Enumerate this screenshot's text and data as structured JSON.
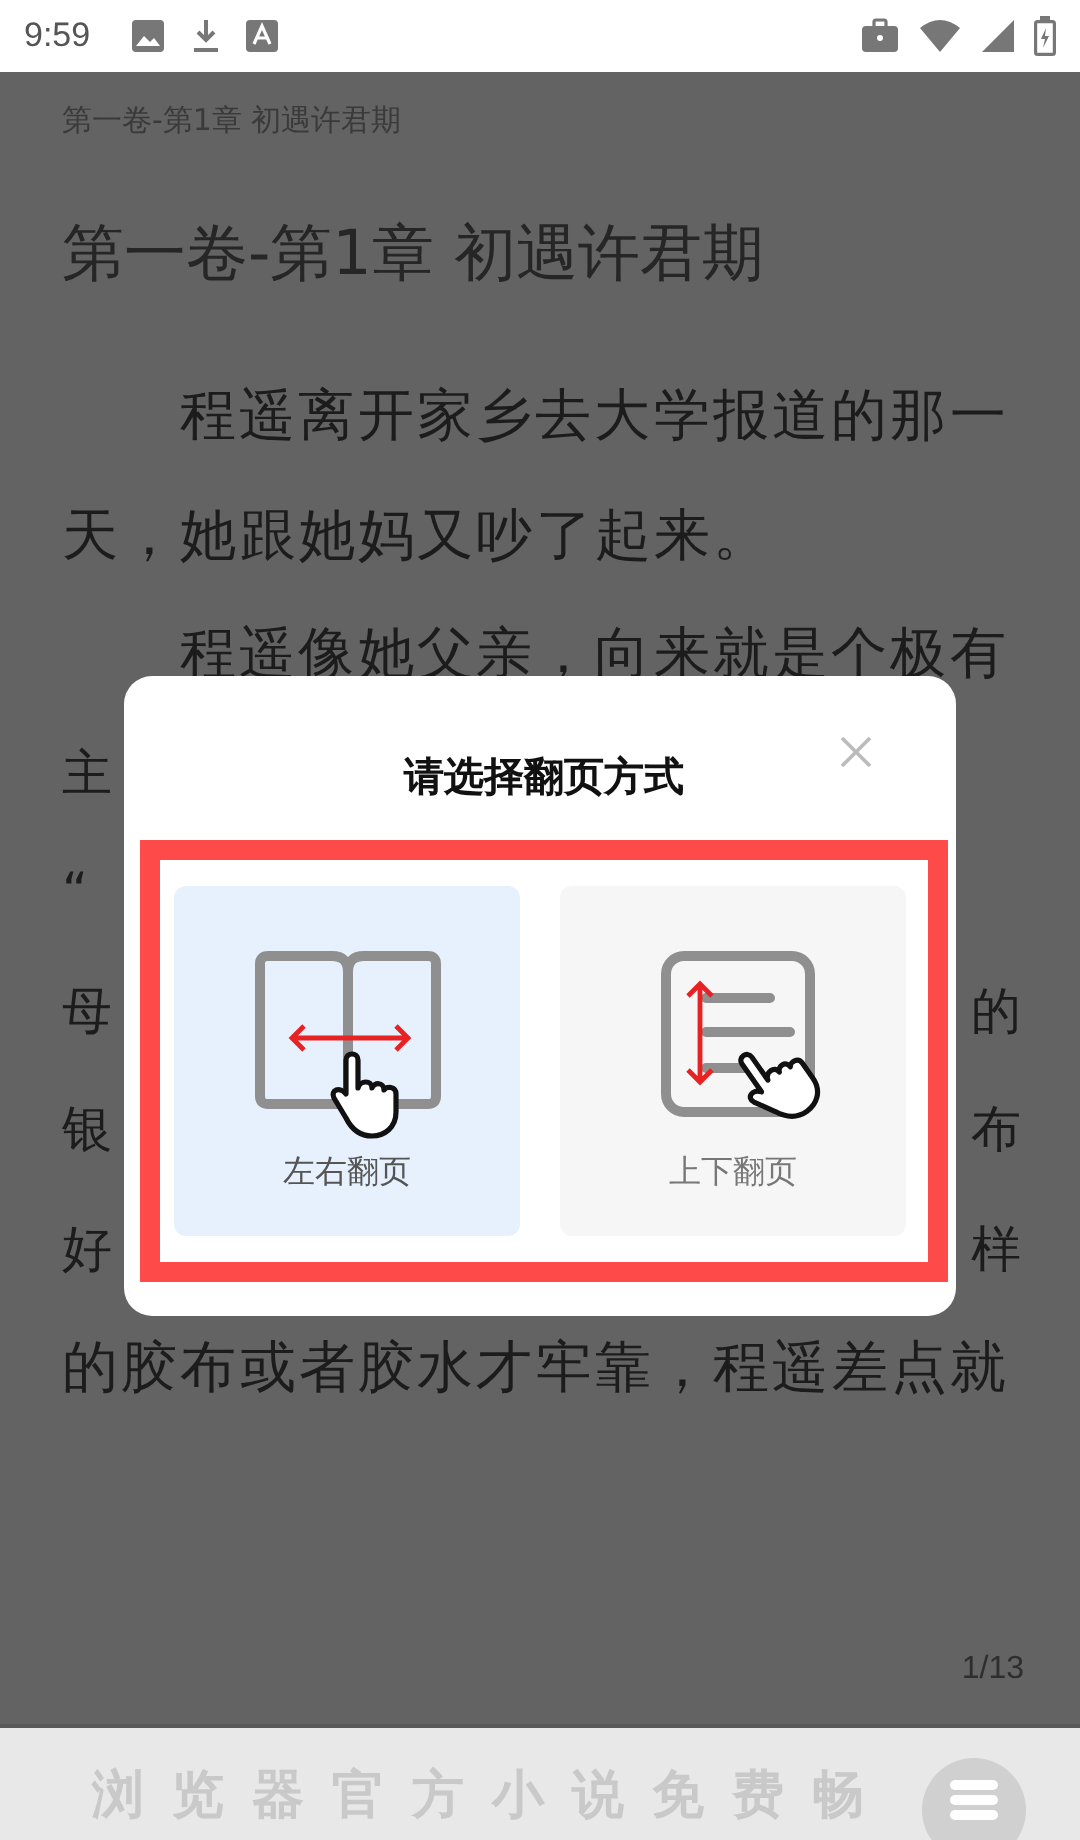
{
  "status_bar": {
    "time": "9:59"
  },
  "reader": {
    "header": "第一卷-第1章 初遇许君期",
    "chapter_title": "第一卷-第1章 初遇许君期",
    "lines": [
      {
        "kind": "indent",
        "text": "程遥离开家乡去大学报道的那一"
      },
      {
        "kind": "plain",
        "text": "天，她跟她妈又吵了起来。"
      },
      {
        "kind": "indent",
        "text": "程遥像她父亲，向来就是个极有"
      },
      {
        "kind": "split",
        "left": "主"
      },
      {
        "kind": "split",
        "left": "“"
      },
      {
        "kind": "split",
        "left": "母",
        "right": "的"
      },
      {
        "kind": "split",
        "left": "银",
        "right": "布"
      },
      {
        "kind": "split",
        "left": "好",
        "right": "样"
      },
      {
        "kind": "plain",
        "text": "的胶布或者胶水才牢靠，程遥差点就"
      }
    ],
    "page_indicator": "1/13"
  },
  "dialog": {
    "title": "请选择翻页方式",
    "options": [
      {
        "kind": "horizontal",
        "label": "左右翻页",
        "selected": true
      },
      {
        "kind": "vertical",
        "label": "上下翻页",
        "selected": false
      }
    ]
  },
  "banner": {
    "text": "浏览器官方小说免费畅"
  }
}
